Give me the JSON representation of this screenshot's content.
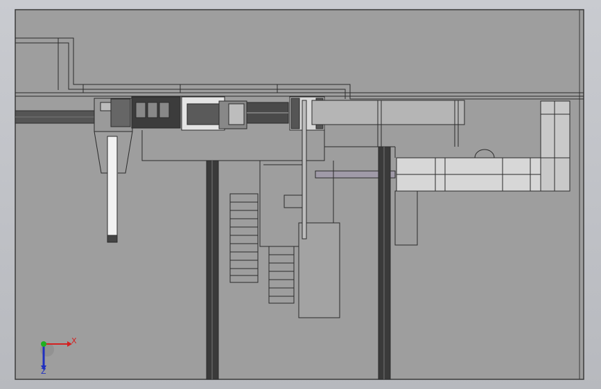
{
  "view": {
    "background_color": "#9e9e9e",
    "sheet_border_color": "#3a3a3a",
    "line_color": "#2a2a2a",
    "triad": {
      "x_label": "X",
      "z_label": "Z",
      "x_color": "#d42020",
      "y_color": "#20b020",
      "z_color": "#2030c0"
    }
  }
}
